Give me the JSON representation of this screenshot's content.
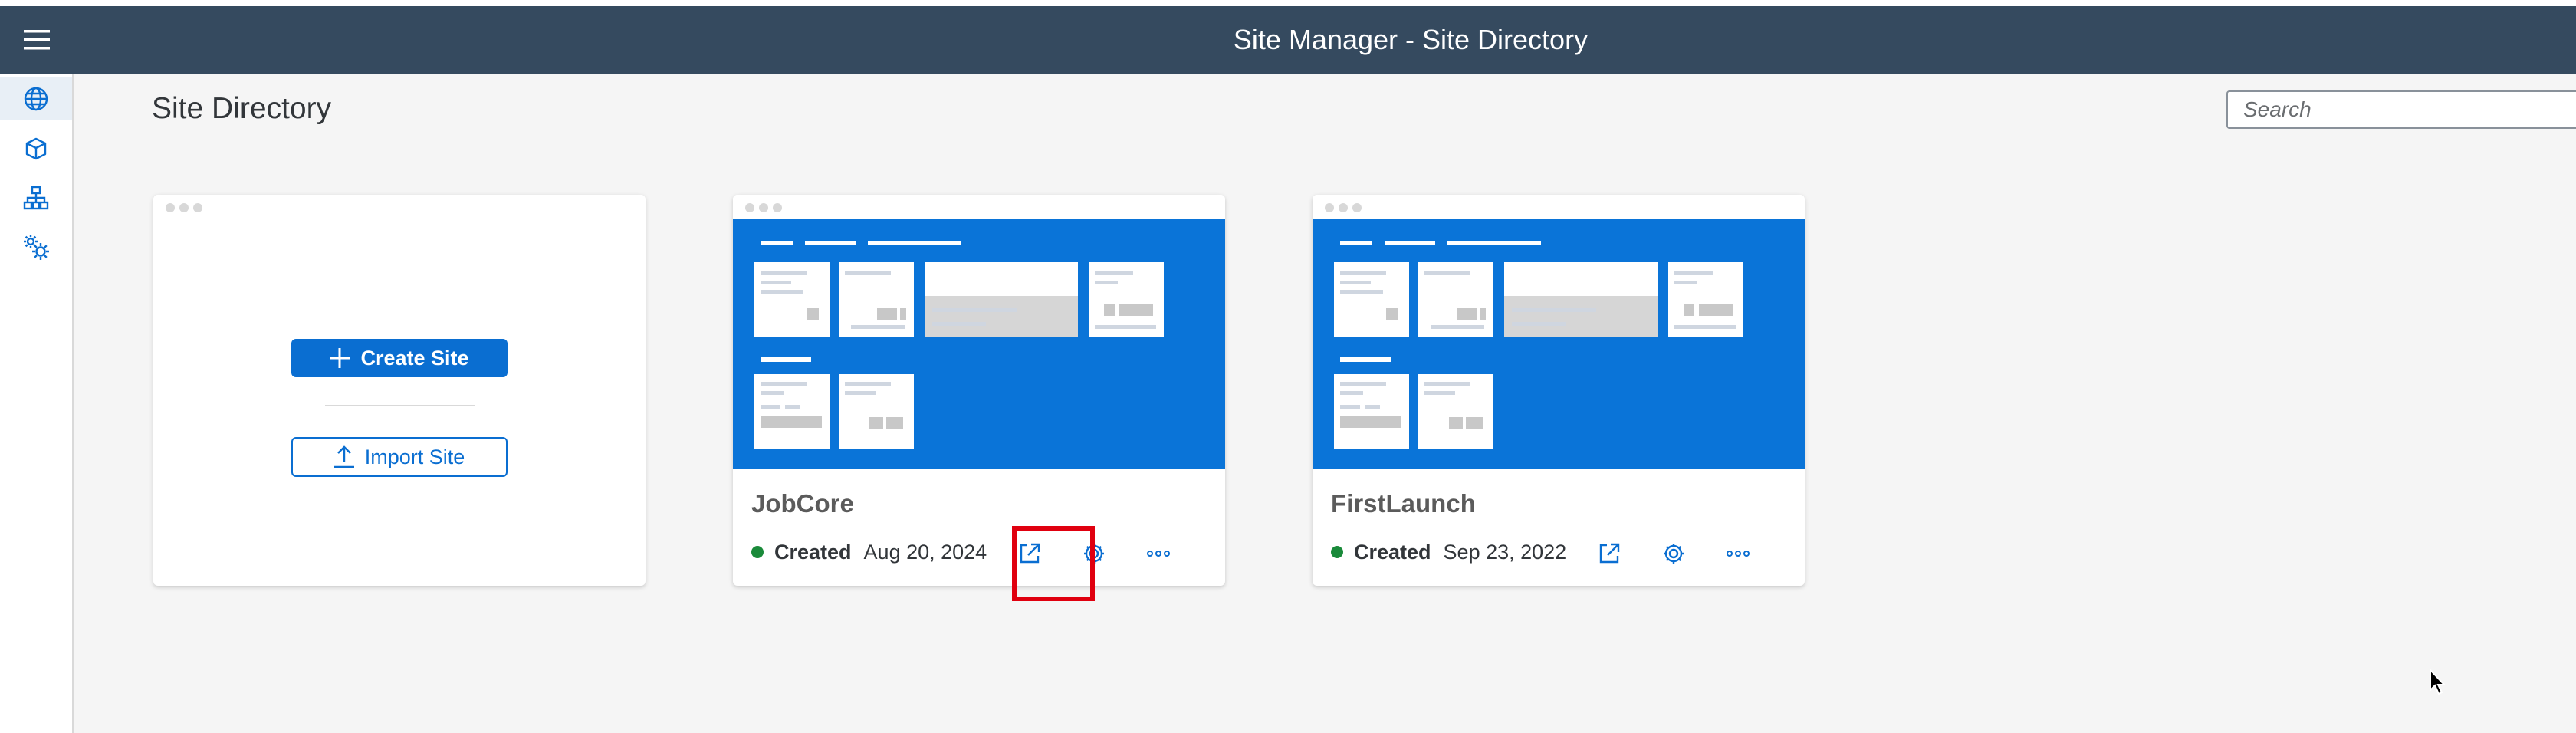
{
  "header": {
    "title": "Site Manager - Site Directory",
    "background_color": "#354a5f"
  },
  "sidebar": {
    "items": [
      {
        "icon": "globe-icon",
        "active": true
      },
      {
        "icon": "cube-icon",
        "active": false
      },
      {
        "icon": "hierarchy-icon",
        "active": false
      },
      {
        "icon": "settings-gears-icon",
        "active": false
      }
    ]
  },
  "page": {
    "title": "Site Directory"
  },
  "search": {
    "placeholder": "Search",
    "value": ""
  },
  "create_card": {
    "create_label": "Create Site",
    "import_label": "Import Site"
  },
  "sites": [
    {
      "name": "JobCore",
      "status": "Created",
      "status_color": "#1a8a3a",
      "date": "Aug 20, 2024",
      "actions": [
        "launch-icon",
        "settings-icon",
        "overflow-icon"
      ],
      "highlighted_action": "launch-icon"
    },
    {
      "name": "FirstLaunch",
      "status": "Created",
      "status_color": "#1a8a3a",
      "date": "Sep 23, 2022",
      "actions": [
        "launch-icon",
        "settings-icon",
        "overflow-icon"
      ]
    }
  ],
  "colors": {
    "accent": "#0a6ed1",
    "preview_blue": "#0a74d8",
    "highlight": "#e0000f",
    "page_background": "#f5f5f5"
  }
}
